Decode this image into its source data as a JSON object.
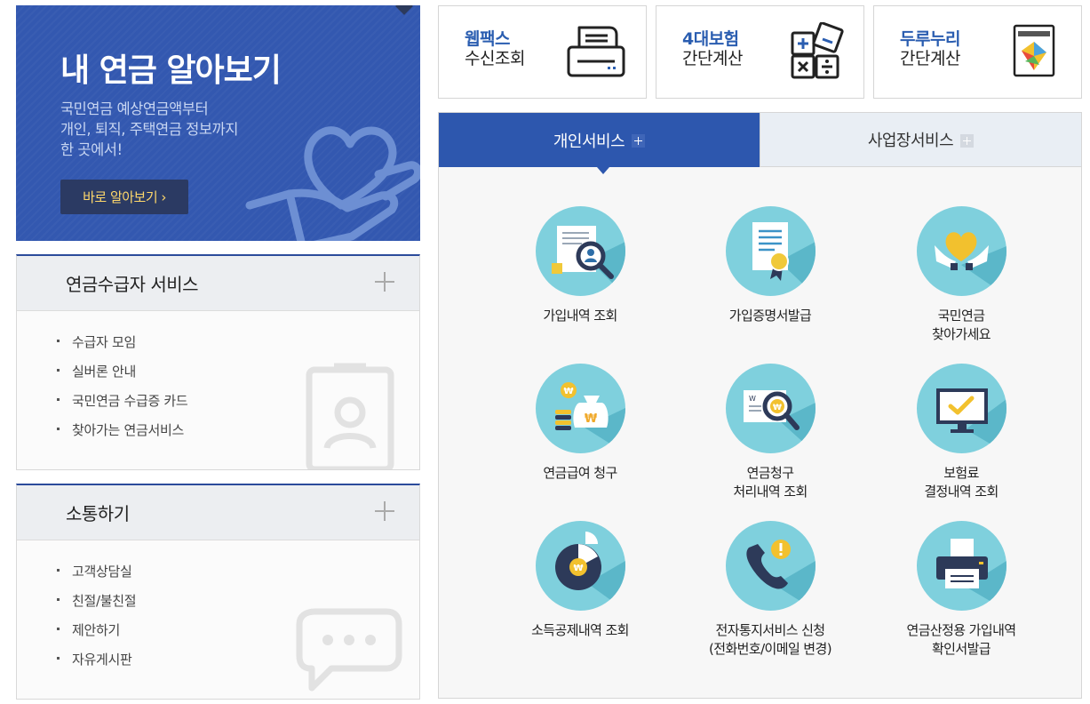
{
  "hero": {
    "title": "내 연금 알아보기",
    "desc": [
      "국민연금 예상연금액부터",
      "개인, 퇴직, 주택연금 정보까지",
      "한 곳에서!"
    ],
    "button": "바로 알아보기 ›"
  },
  "panels": [
    {
      "title": "연금수급자 서비스",
      "items": [
        "수급자 모임",
        "실버론 안내",
        "국민연금 수급증 카드",
        "찾아가는 연금서비스"
      ]
    },
    {
      "title": "소통하기",
      "items": [
        "고객상담실",
        "친절/불친절",
        "제안하기",
        "자유게시판"
      ]
    }
  ],
  "quick": [
    {
      "line1": "웹팩스",
      "line2": "수신조회",
      "icon": "fax-icon"
    },
    {
      "line1": "4대보험",
      "line2": "간단계산",
      "icon": "calculator-icon"
    },
    {
      "line1": "두루누리",
      "line2": "간단계산",
      "icon": "durunuri-icon"
    }
  ],
  "tabs": {
    "personal": "개인서비스",
    "business": "사업장서비스"
  },
  "services": [
    {
      "lines": [
        "가입내역 조회"
      ],
      "icon": "search-document-icon"
    },
    {
      "lines": [
        "가입증명서발급"
      ],
      "icon": "certificate-icon"
    },
    {
      "lines": [
        "국민연금",
        "찾아가세요"
      ],
      "icon": "heart-hands-icon"
    },
    {
      "lines": [
        "연금급여 청구"
      ],
      "icon": "money-bag-icon"
    },
    {
      "lines": [
        "연금청구",
        "처리내역 조회"
      ],
      "icon": "magnifier-coin-icon"
    },
    {
      "lines": [
        "보험료",
        "결정내역 조회"
      ],
      "icon": "monitor-check-icon"
    },
    {
      "lines": [
        "소득공제내역 조회"
      ],
      "icon": "pie-chart-icon"
    },
    {
      "lines": [
        "전자통지서비스 신청",
        "(전화번호/이메일 변경)"
      ],
      "icon": "phone-alert-icon"
    },
    {
      "lines": [
        "연금산정용 가입내역",
        "확인서발급"
      ],
      "icon": "printer-icon"
    }
  ],
  "colors": {
    "brand": "#2d57ae",
    "hero_bg": "#3358b0",
    "icon_circle": "#7fd0dd",
    "accent_yellow": "#ffd86b"
  }
}
